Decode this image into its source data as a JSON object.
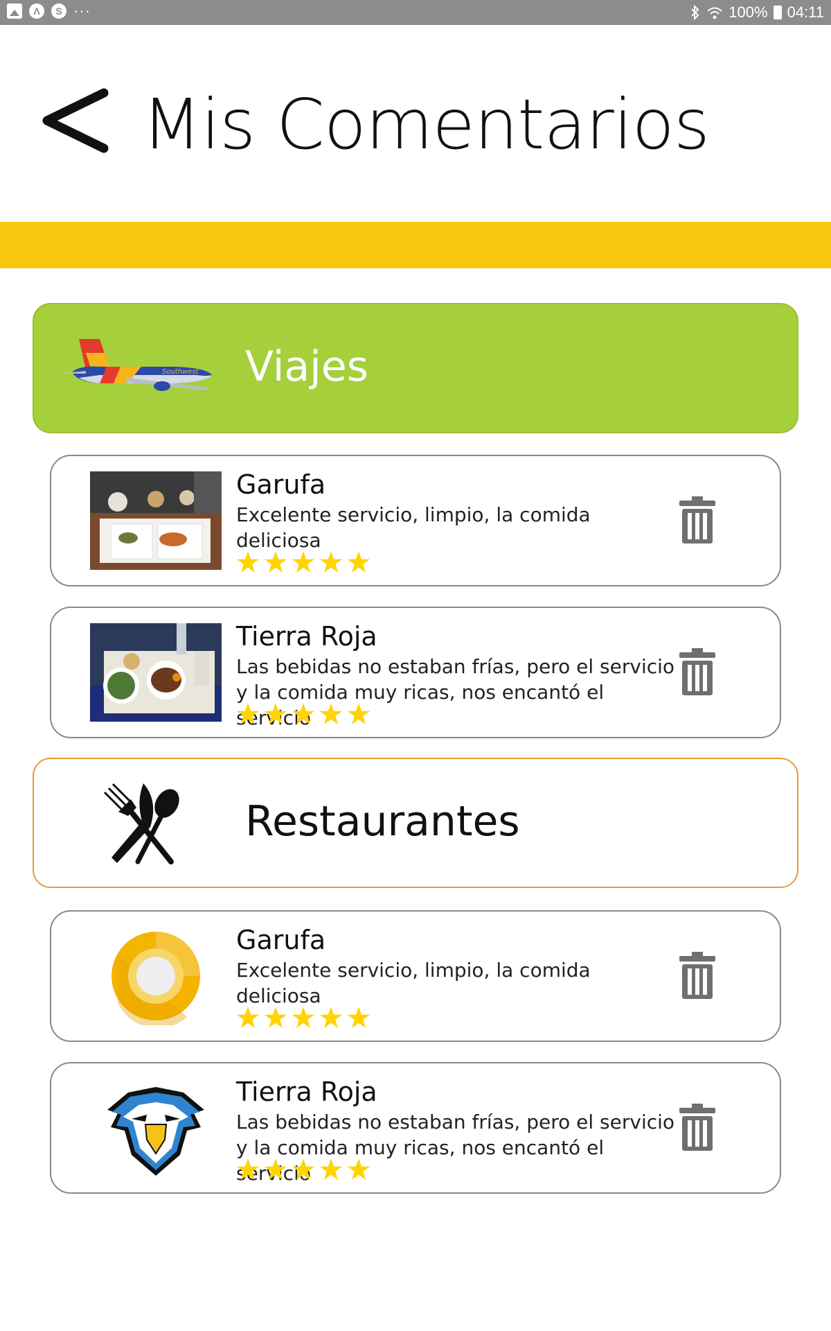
{
  "status_bar": {
    "left_icons": [
      "gallery-icon",
      "a-app-icon",
      "s-app-icon",
      "more-dots-icon"
    ],
    "dots": "···",
    "battery": "100%",
    "time": "04:11"
  },
  "header": {
    "title": "Mis Comentarios"
  },
  "colors": {
    "accent_yellow": "#f9c80e",
    "viajes_green": "#a6cf3c",
    "restaurantes_border": "#e89a3c",
    "star": "#ffd400",
    "trash": "#6f6f6f"
  },
  "sections": [
    {
      "label": "Viajes",
      "icon": "airplane-icon",
      "reviews": [
        {
          "name": "Garufa",
          "text": "Excelente servicio, limpio, la comida deliciosa",
          "rating": 5,
          "image": "airline-meal-photo"
        },
        {
          "name": "Tierra Roja",
          "text": "Las bebidas no estaban frías, pero el servicio y la comida muy ricas, nos encantó el servicio",
          "rating": 5,
          "image": "airline-meal-photo-2"
        }
      ]
    },
    {
      "label": "Restaurantes",
      "icon": "cutlery-icon",
      "reviews": [
        {
          "name": "Garufa",
          "text": "Excelente servicio, limpio, la comida deliciosa",
          "rating": 5,
          "image": "android-o-logo"
        },
        {
          "name": "Tierra Roja",
          "text": "Las bebidas no estaban frías, pero el servicio y la comida muy ricas, nos encantó el servicio",
          "rating": 5,
          "image": "eagle-mascot-logo"
        }
      ]
    }
  ]
}
